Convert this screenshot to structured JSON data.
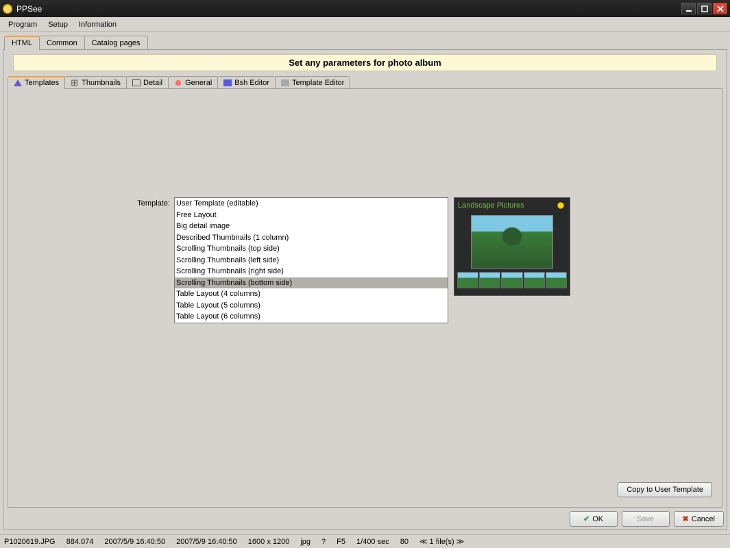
{
  "window": {
    "title": "PPSee"
  },
  "menubar": {
    "items": [
      "Program",
      "Setup",
      "Information"
    ]
  },
  "top_tabs": {
    "items": [
      "HTML",
      "Common",
      "Catalog pages"
    ],
    "active": 0
  },
  "banner": "Set any parameters for photo album",
  "sub_tabs": {
    "items": [
      "Templates",
      "Thumbnails",
      "Detail",
      "General",
      "Bsh Editor",
      "Template Editor"
    ],
    "active": 0
  },
  "template": {
    "label": "Template:",
    "options": [
      "User Template (editable)",
      "Free Layout",
      "Big detail image",
      "Described Thumbnails (1 column)",
      "Scrolling Thumbnails  (top side)",
      "Scrolling Thumbnails  (left side)",
      "Scrolling Thumbnails  (right side)",
      "Scrolling Thumbnails  (bottom side)",
      "Table Layout (4 columns)",
      "Table Layout (5 columns)",
      "Table Layout (6 columns)"
    ],
    "selected": 7
  },
  "preview": {
    "title": "Landscape Pictures"
  },
  "buttons": {
    "copy": "Copy to User Template",
    "ok": "OK",
    "save": "Save",
    "cancel": "Cancel"
  },
  "statusbar": {
    "filename": "P1020619.JPG",
    "size": "884.074",
    "date1": "2007/5/9 16:40:50",
    "date2": "2007/5/9 16:40:50",
    "dimensions": "1600 x 1200",
    "format": "jpg",
    "q": "?",
    "fstop": "F5",
    "shutter": "1/400 sec",
    "iso": "80",
    "nav": "≪ 1 file(s) ≫"
  }
}
